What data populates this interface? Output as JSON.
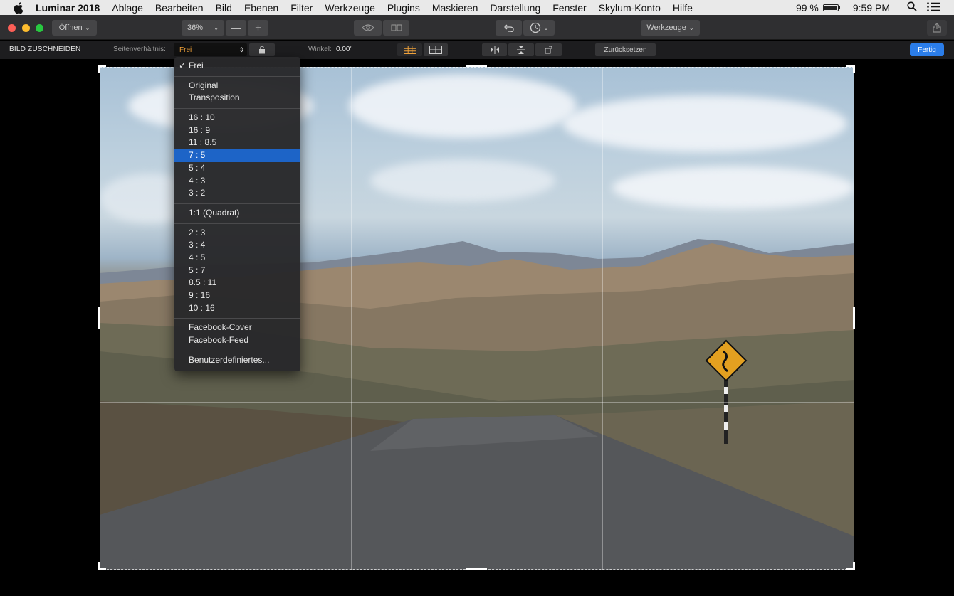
{
  "menubar": {
    "app_name": "Luminar 2018",
    "items": [
      "Ablage",
      "Bearbeiten",
      "Bild",
      "Ebenen",
      "Filter",
      "Werkzeuge",
      "Plugins",
      "Maskieren",
      "Darstellung",
      "Fenster",
      "Skylum-Konto",
      "Hilfe"
    ],
    "battery": "99 %",
    "clock": "9:59 PM"
  },
  "toolbar": {
    "open_label": "Öffnen",
    "zoom_value": "36%",
    "zoom_out": "—",
    "zoom_in": "+",
    "tools_label": "Werkzeuge"
  },
  "cropbar": {
    "title": "BILD ZUSCHNEIDEN",
    "aspect_label": "Seitenverhältnis:",
    "aspect_value": "Frei",
    "angle_label": "Winkel:",
    "angle_value": "0.00°",
    "reset_label": "Zurücksetzen",
    "done_label": "Fertig"
  },
  "dropdown": {
    "checked": "Frei",
    "selected": "7 : 5",
    "groups": [
      [
        "Frei"
      ],
      [
        "Original",
        "Transposition"
      ],
      [
        "16 : 10",
        "16 : 9",
        "11 : 8.5",
        "7 : 5",
        "5 : 4",
        "4 : 3",
        "3 : 2"
      ],
      [
        "1:1 (Quadrat)"
      ],
      [
        "2 : 3",
        "3 : 4",
        "4 : 5",
        "5 : 7",
        "8.5 : 11",
        "9 : 16",
        "10 : 16"
      ],
      [
        "Facebook-Cover",
        "Facebook-Feed"
      ],
      [
        "Benutzerdefiniertes..."
      ]
    ]
  }
}
